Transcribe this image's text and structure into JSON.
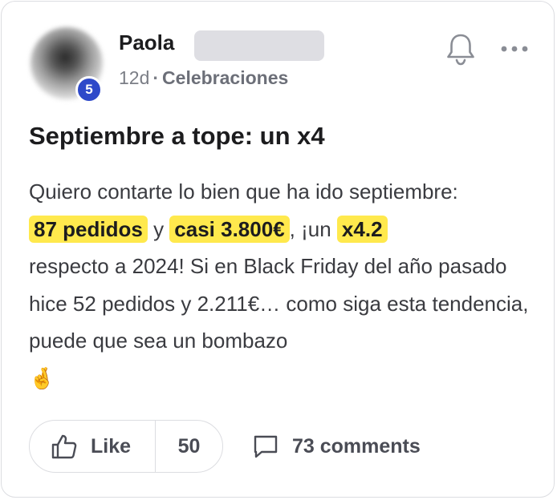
{
  "post": {
    "author": {
      "name": "Paola",
      "level": "5"
    },
    "time_ago": "12d",
    "separator": "·",
    "category": "Celebraciones",
    "title": "Septiembre a tope: un x4",
    "body": {
      "intro": "Quiero contarte lo bien que ha ido septiembre:",
      "highlight_orders": "87 pedidos",
      "connector_y": "y",
      "highlight_amount": "casi 3.800€",
      "comma_un": ", ¡un",
      "highlight_multiplier": "x4.2",
      "rest": "respecto a 2024! Si en Black Friday del año pasado hice 52 pedidos y 2.211€… como siga esta tendencia, puede que sea un bombazo",
      "emoji": "🤞"
    },
    "actions": {
      "like_label": "Like",
      "like_count": "50",
      "comments_label": "73 comments"
    },
    "icons": {
      "bell": "bell-icon",
      "more": "more-horizontal-icon",
      "like": "thumbs-up-icon",
      "comment": "comment-icon"
    },
    "colors": {
      "highlight": "#ffe94d",
      "level_badge": "#2e49c9",
      "text": "#3a3b40"
    }
  }
}
